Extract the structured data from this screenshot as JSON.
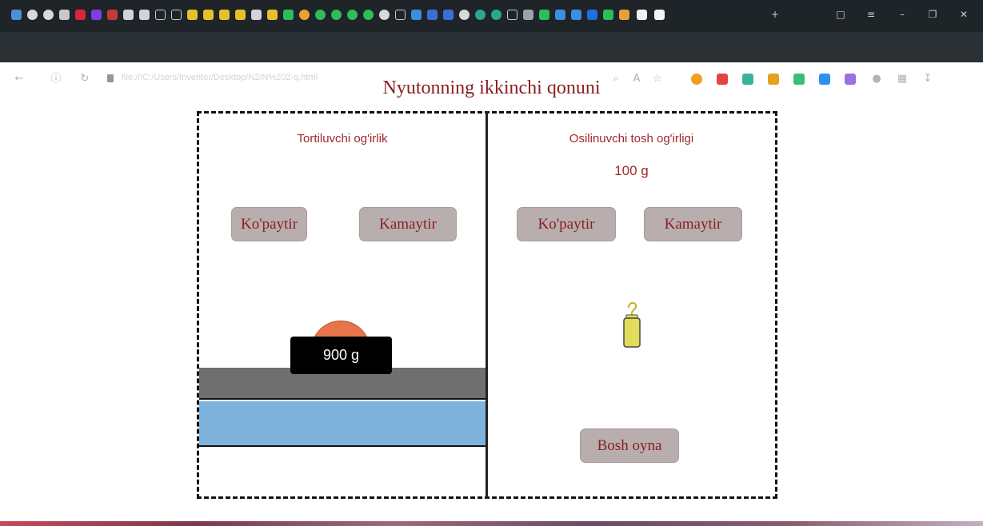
{
  "browser": {
    "url": "file:///C:/Users/Inventor/Desktop/N2/N%202-q.html"
  },
  "page": {
    "title": "Nyutonning ikkinchi qonuni"
  },
  "left_panel": {
    "title": "Tortiluvchi og'irlik",
    "increase_label": "Ko'paytir",
    "decrease_label": "Kamaytir",
    "mass_label": "900 g"
  },
  "right_panel": {
    "title": "Osilinuvchi tosh og'irligi",
    "mass_value": "100 g",
    "increase_label": "Ko'paytir",
    "decrease_label": "Kamaytir",
    "home_label": "Bosh oyna"
  },
  "colors": {
    "title": "#8b1e22",
    "button_bg": "#b9aeae",
    "dome": "#e8754a",
    "track": "#6f6f6f",
    "water": "#7eb3dd",
    "weight": "#e2dc5a"
  }
}
